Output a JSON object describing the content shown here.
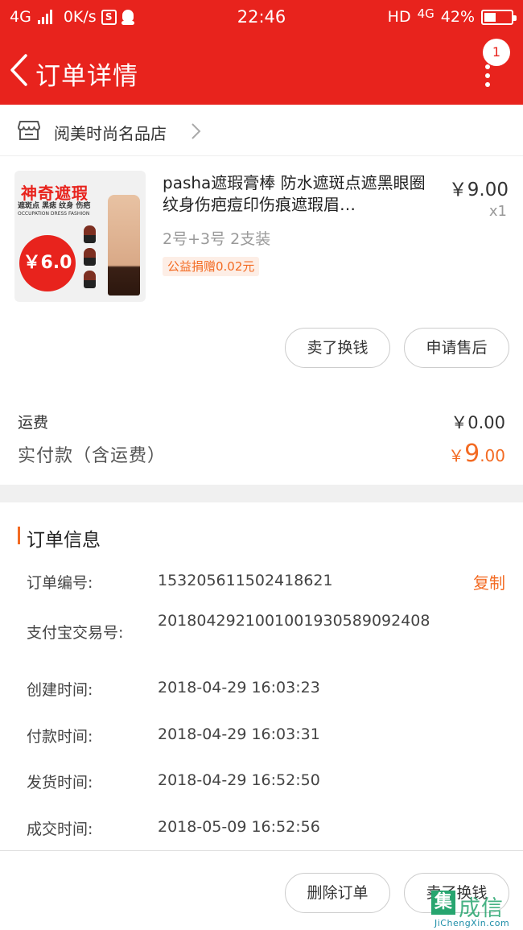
{
  "status_bar": {
    "network": "4G",
    "speed": "0K/s",
    "sim_icon_label": "S",
    "time": "22:46",
    "hd": "HD",
    "network_right": "4G",
    "battery": "42%"
  },
  "header": {
    "title": "订单详情",
    "notification_count": "1",
    "background_color": "#e8231d"
  },
  "shop": {
    "name": "阅美时尚名品店"
  },
  "product": {
    "title": "pasha遮瑕膏棒 防水遮斑点遮黑眼圈 纹身伤疤痘印伤痕遮瑕眉…",
    "price": "￥9.00",
    "quantity": "x1",
    "spec": "2号+3号 2支装",
    "tag": "公益捐赠0.02元",
    "image": {
      "headline": "神奇遮瑕",
      "subline": "遮斑点 黑痣 纹身 伤疤",
      "subline_en": "OCCUPATION DRESS FASHION",
      "price_badge": "￥6.0"
    }
  },
  "product_actions": {
    "sell_label": "卖了换钱",
    "after_sale_label": "申请售后"
  },
  "totals": {
    "shipping_label": "运费",
    "shipping_value": "￥0.00",
    "paid_label": "实付款（含运费）",
    "paid_currency": "￥",
    "paid_major": "9",
    "paid_minor": ".00",
    "accent_color": "#f36b23"
  },
  "order_info": {
    "title": "订单信息",
    "copy_label": "复制",
    "rows": [
      {
        "label": "订单编号:",
        "value": "153205611502418621"
      },
      {
        "label": "支付宝交易号:",
        "value": "2018042921001001930589092408"
      },
      {
        "label": "创建时间:",
        "value": "2018-04-29 16:03:23"
      },
      {
        "label": "付款时间:",
        "value": "2018-04-29 16:03:31"
      },
      {
        "label": "发货时间:",
        "value": "2018-04-29 16:52:50"
      },
      {
        "label": "成交时间:",
        "value": "2018-05-09 16:52:56"
      }
    ]
  },
  "bottom_actions": {
    "delete_label": "删除订单",
    "sell_label": "卖了换钱"
  },
  "watermark": {
    "box_char": "集",
    "cn": "成信",
    "en": "JiChengXin.com"
  }
}
